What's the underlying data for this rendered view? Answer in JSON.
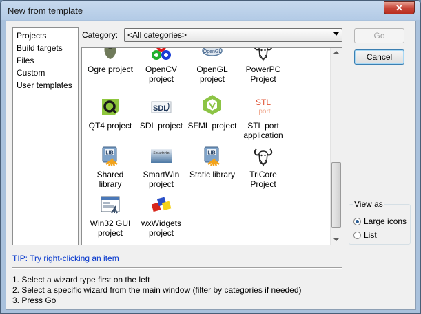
{
  "window": {
    "title": "New from template",
    "close_label": "✕"
  },
  "sidebar": {
    "items": [
      {
        "label": "Projects"
      },
      {
        "label": "Build targets"
      },
      {
        "label": "Files"
      },
      {
        "label": "Custom"
      },
      {
        "label": "User templates"
      }
    ]
  },
  "category": {
    "label": "Category:",
    "value": "<All categories>"
  },
  "templates": [
    {
      "label": "Ogre project",
      "icon": "ogre-icon"
    },
    {
      "label": "OpenCV project",
      "icon": "opencv-icon"
    },
    {
      "label": "OpenGL project",
      "icon": "opengl-icon"
    },
    {
      "label": "PowerPC Project",
      "icon": "gnu-icon"
    },
    {
      "label": "QT4 project",
      "icon": "qt-icon"
    },
    {
      "label": "SDL project",
      "icon": "sdl-icon"
    },
    {
      "label": "SFML project",
      "icon": "sfml-icon"
    },
    {
      "label": "STL port application",
      "icon": "stlport-icon"
    },
    {
      "label": "Shared library",
      "icon": "library-icon"
    },
    {
      "label": "SmartWin project",
      "icon": "smartwin-icon"
    },
    {
      "label": "Static library",
      "icon": "library-icon"
    },
    {
      "label": "TriCore Project",
      "icon": "gnu-icon"
    },
    {
      "label": "Win32 GUI project",
      "icon": "win32-icon"
    },
    {
      "label": "wxWidgets project",
      "icon": "wxwidgets-icon"
    }
  ],
  "buttons": {
    "go": "Go",
    "cancel": "Cancel"
  },
  "view_as": {
    "legend": "View as",
    "options": [
      {
        "label": "Large icons",
        "selected": true
      },
      {
        "label": "List",
        "selected": false
      }
    ]
  },
  "tip": "TIP: Try right-clicking an item",
  "instructions": [
    "1. Select a wizard type first on the left",
    "2. Select a specific wizard from the main window (filter by categories if needed)",
    "3. Press Go"
  ]
}
